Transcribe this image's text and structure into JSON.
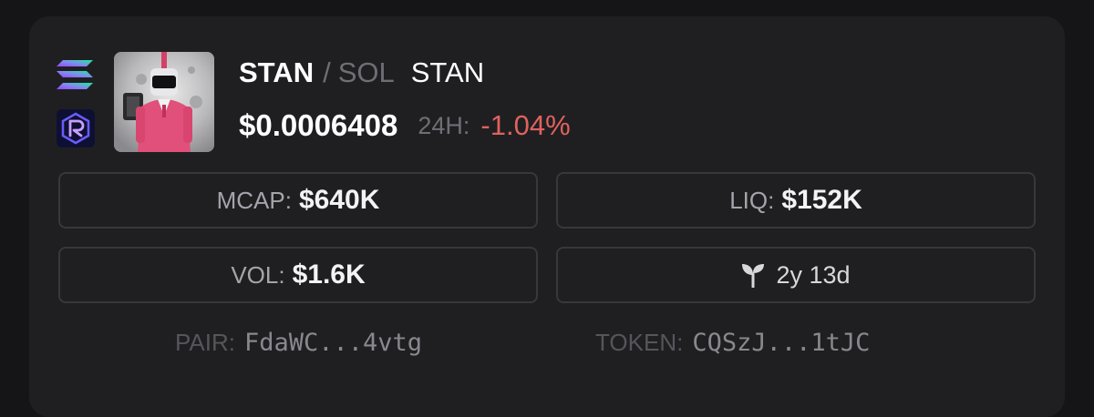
{
  "colors": {
    "background": "#151517",
    "card": "#1f1f22",
    "text_primary": "#ffffff",
    "text_muted": "#6e6e74",
    "negative_change": "#e0625d",
    "box_border": "#37373c"
  },
  "icons": {
    "chain": "solana-icon",
    "dex": "raydium-icon",
    "age": "sprout-icon",
    "token_image": "token-avatar"
  },
  "header": {
    "symbol": "STAN",
    "separator": "/",
    "quote": "SOL",
    "name": "STAN"
  },
  "price": {
    "value": "$0.0006408",
    "change_label": "24H:",
    "change_value": "-1.04%"
  },
  "stats": {
    "mcap": {
      "label": "MCAP:",
      "value": "$640K"
    },
    "liq": {
      "label": "LIQ:",
      "value": "$152K"
    },
    "vol": {
      "label": "VOL:",
      "value": "$1.6K"
    },
    "age": {
      "value": "2y 13d"
    }
  },
  "addresses": {
    "pair": {
      "label": "PAIR:",
      "value": "FdaWC...4vtg"
    },
    "token": {
      "label": "TOKEN:",
      "value": "CQSzJ...1tJC"
    }
  }
}
